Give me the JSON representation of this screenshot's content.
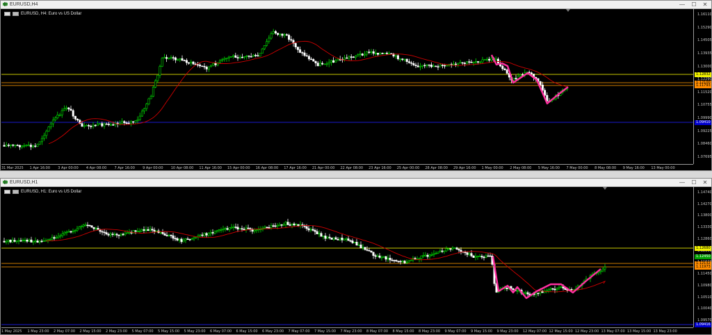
{
  "windows": [
    {
      "title": "EURUSD,H4",
      "symbol_header": "EURUSD, H4:  Euro vs US Dollar",
      "price_ticks": [
        "1.16110",
        "1.15290",
        "1.14505",
        "1.13935",
        "1.13000",
        "1.12290",
        "1.11520",
        "1.10755",
        "1.09990",
        "1.09225",
        "1.08460",
        "1.07695"
      ],
      "price_labels": [
        {
          "text": "1.12832",
          "color": "#f0f000",
          "textcolor": "#000000"
        },
        {
          "text": "1.12100",
          "color": "#ff8c00",
          "textcolor": "#000000"
        },
        {
          "text": "1.11793",
          "color": "#ff8c00",
          "textcolor": "#000000"
        },
        {
          "text": "1.09410",
          "color": "#0000cd",
          "textcolor": "#ffffff"
        }
      ],
      "time_ticks": [
        "31 Mar 2025",
        "1 Apr 16:00",
        "3 Apr 00:00",
        "4 Apr 08:00",
        "7 Apr 16:00",
        "9 Apr 00:00",
        "10 Apr 08:00",
        "11 Apr 16:00",
        "15 Apr 00:00",
        "16 Apr 08:00",
        "17 Apr 16:00",
        "21 Apr 00:00",
        "22 Apr 08:00",
        "23 Apr 16:00",
        "25 Apr 00:00",
        "28 Apr 08:00",
        "29 Apr 16:00",
        "1 May 00:00",
        "2 May 08:00",
        "5 May 16:00",
        "7 May 00:00",
        "8 May 08:00",
        "9 May 16:00",
        "13 May 00:00"
      ]
    },
    {
      "title": "EURUSD,H1",
      "symbol_header": "EURUSD, H1:  Euro vs US Dollar",
      "price_ticks": [
        "1.14740",
        "1.14270",
        "1.13800",
        "1.13330",
        "1.12860",
        "1.12390",
        "1.11920",
        "1.11450",
        "1.10980",
        "1.10510",
        "1.10040",
        "1.09570"
      ],
      "price_labels": [
        {
          "text": "1.12680",
          "color": "#f0f000",
          "textcolor": "#000000"
        },
        {
          "text": "1.12450",
          "color": "#00a000",
          "textcolor": "#ffffff"
        },
        {
          "text": "1.12132",
          "color": "#ff8c00",
          "textcolor": "#000000"
        },
        {
          "text": "1.11973",
          "color": "#ff8c00",
          "textcolor": "#000000"
        },
        {
          "text": "1.09416",
          "color": "#0000cd",
          "textcolor": "#ffffff"
        }
      ],
      "time_ticks": [
        "1 May 2025",
        "1 May 23:00",
        "2 May 07:00",
        "2 May 15:00",
        "2 May 23:00",
        "5 May 07:00",
        "5 May 15:00",
        "5 May 23:00",
        "6 May 07:00",
        "6 May 15:00",
        "6 May 23:00",
        "7 May 07:00",
        "7 May 15:00",
        "7 May 23:00",
        "8 May 07:00",
        "8 May 15:00",
        "8 May 23:00",
        "9 May 07:00",
        "9 May 15:00",
        "9 May 23:00",
        "12 May 07:00",
        "12 May 15:00",
        "12 May 23:00",
        "13 May 07:00",
        "13 May 15:00",
        "13 May 23:00"
      ]
    }
  ],
  "window_buttons": {
    "minimize": "—",
    "maximize": "☐",
    "close": "✕"
  },
  "colors": {
    "bull_candle": "#00e000",
    "bear_candle": "#ffffff",
    "moving_average": "#d00000",
    "zigzag": "#ff2fa0",
    "level_yellow": "#c8c800",
    "level_orange": "#c87800",
    "level_blue": "#1a1ad0",
    "background": "#000000"
  }
}
